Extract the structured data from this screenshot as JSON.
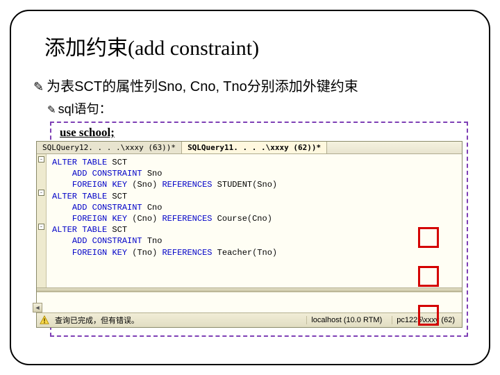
{
  "title": "添加约束(add constraint)",
  "bullet1": "为表SCT的属性列Sno, Cno, Tno分别添加外键约束",
  "sub1": "sql语句：",
  "use_line": "use school;",
  "tabs": {
    "inactive": "SQLQuery12. . . .\\xxxy (63))*",
    "active": "SQLQuery11. . . .\\xxxy (62))*"
  },
  "code": {
    "l1a": "ALTER",
    "l1b": "TABLE",
    "l1c": " SCT",
    "l2a": "ADD",
    "l2b": "CONSTRAINT",
    "l2c": " Sno",
    "l3a": "FOREIGN",
    "l3b": "KEY",
    "l3c": "Sno",
    "l3d": "REFERENCES",
    "l3e": " STUDENT",
    "l3f": "Sno",
    "l4c": " SCT",
    "l5c": " Cno",
    "l6c": "Cno",
    "l6e": " Course",
    "l6f": "Cno",
    "l7c": " SCT",
    "l8c": " Tno",
    "l9c": "Tno",
    "l9e": " Teacher",
    "l9f": "Tno"
  },
  "status": {
    "msg": "查询已完成，但有错误。",
    "host": "localhost (10.0 RTM)",
    "user": "pc1225\\xxxy (62)"
  }
}
